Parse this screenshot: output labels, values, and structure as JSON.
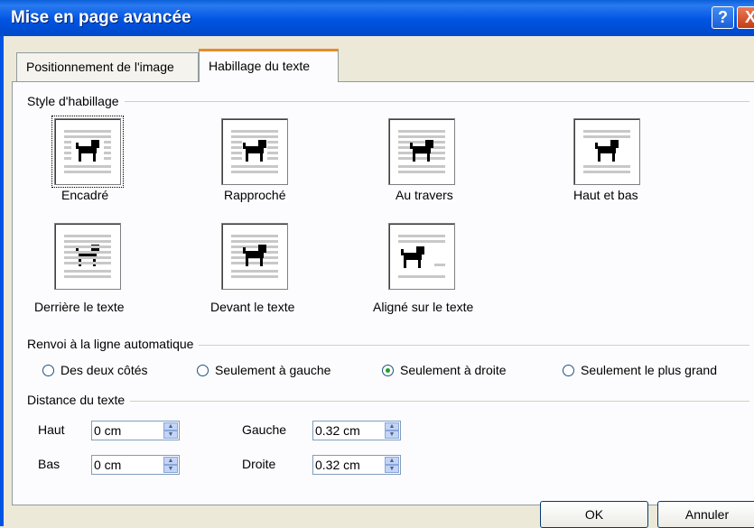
{
  "window": {
    "title": "Mise en page avancée",
    "help_label": "?",
    "close_label": "X"
  },
  "tabs": [
    {
      "label": "Positionnement de l'image",
      "active": false
    },
    {
      "label": "Habillage du texte",
      "active": true
    }
  ],
  "wrap_style": {
    "group_label": "Style d'habillage",
    "options": [
      {
        "label": "Encadré",
        "icon": "square-wrap-icon",
        "selected": true
      },
      {
        "label": "Rapproché",
        "icon": "tight-wrap-icon",
        "selected": false
      },
      {
        "label": "Au travers",
        "icon": "through-wrap-icon",
        "selected": false
      },
      {
        "label": "Haut et bas",
        "icon": "top-bottom-wrap-icon",
        "selected": false
      },
      {
        "label": "Derrière le texte",
        "icon": "behind-text-icon",
        "selected": false
      },
      {
        "label": "Devant le texte",
        "icon": "in-front-text-icon",
        "selected": false
      },
      {
        "label": "Aligné sur le texte",
        "icon": "inline-text-icon",
        "selected": false
      }
    ]
  },
  "wrap_text": {
    "group_label": "Renvoi à la ligne automatique",
    "options": [
      {
        "label": "Des deux côtés",
        "checked": false
      },
      {
        "label": "Seulement à gauche",
        "checked": false
      },
      {
        "label": "Seulement à droite",
        "checked": true
      },
      {
        "label": "Seulement le plus grand",
        "checked": false
      }
    ]
  },
  "distance": {
    "group_label": "Distance du texte",
    "top": {
      "label": "Haut",
      "value": "0 cm"
    },
    "bottom": {
      "label": "Bas",
      "value": "0 cm"
    },
    "left": {
      "label": "Gauche",
      "value": "0.32 cm"
    },
    "right": {
      "label": "Droite",
      "value": "0.32 cm"
    }
  },
  "buttons": {
    "ok": "OK",
    "cancel": "Annuler"
  }
}
